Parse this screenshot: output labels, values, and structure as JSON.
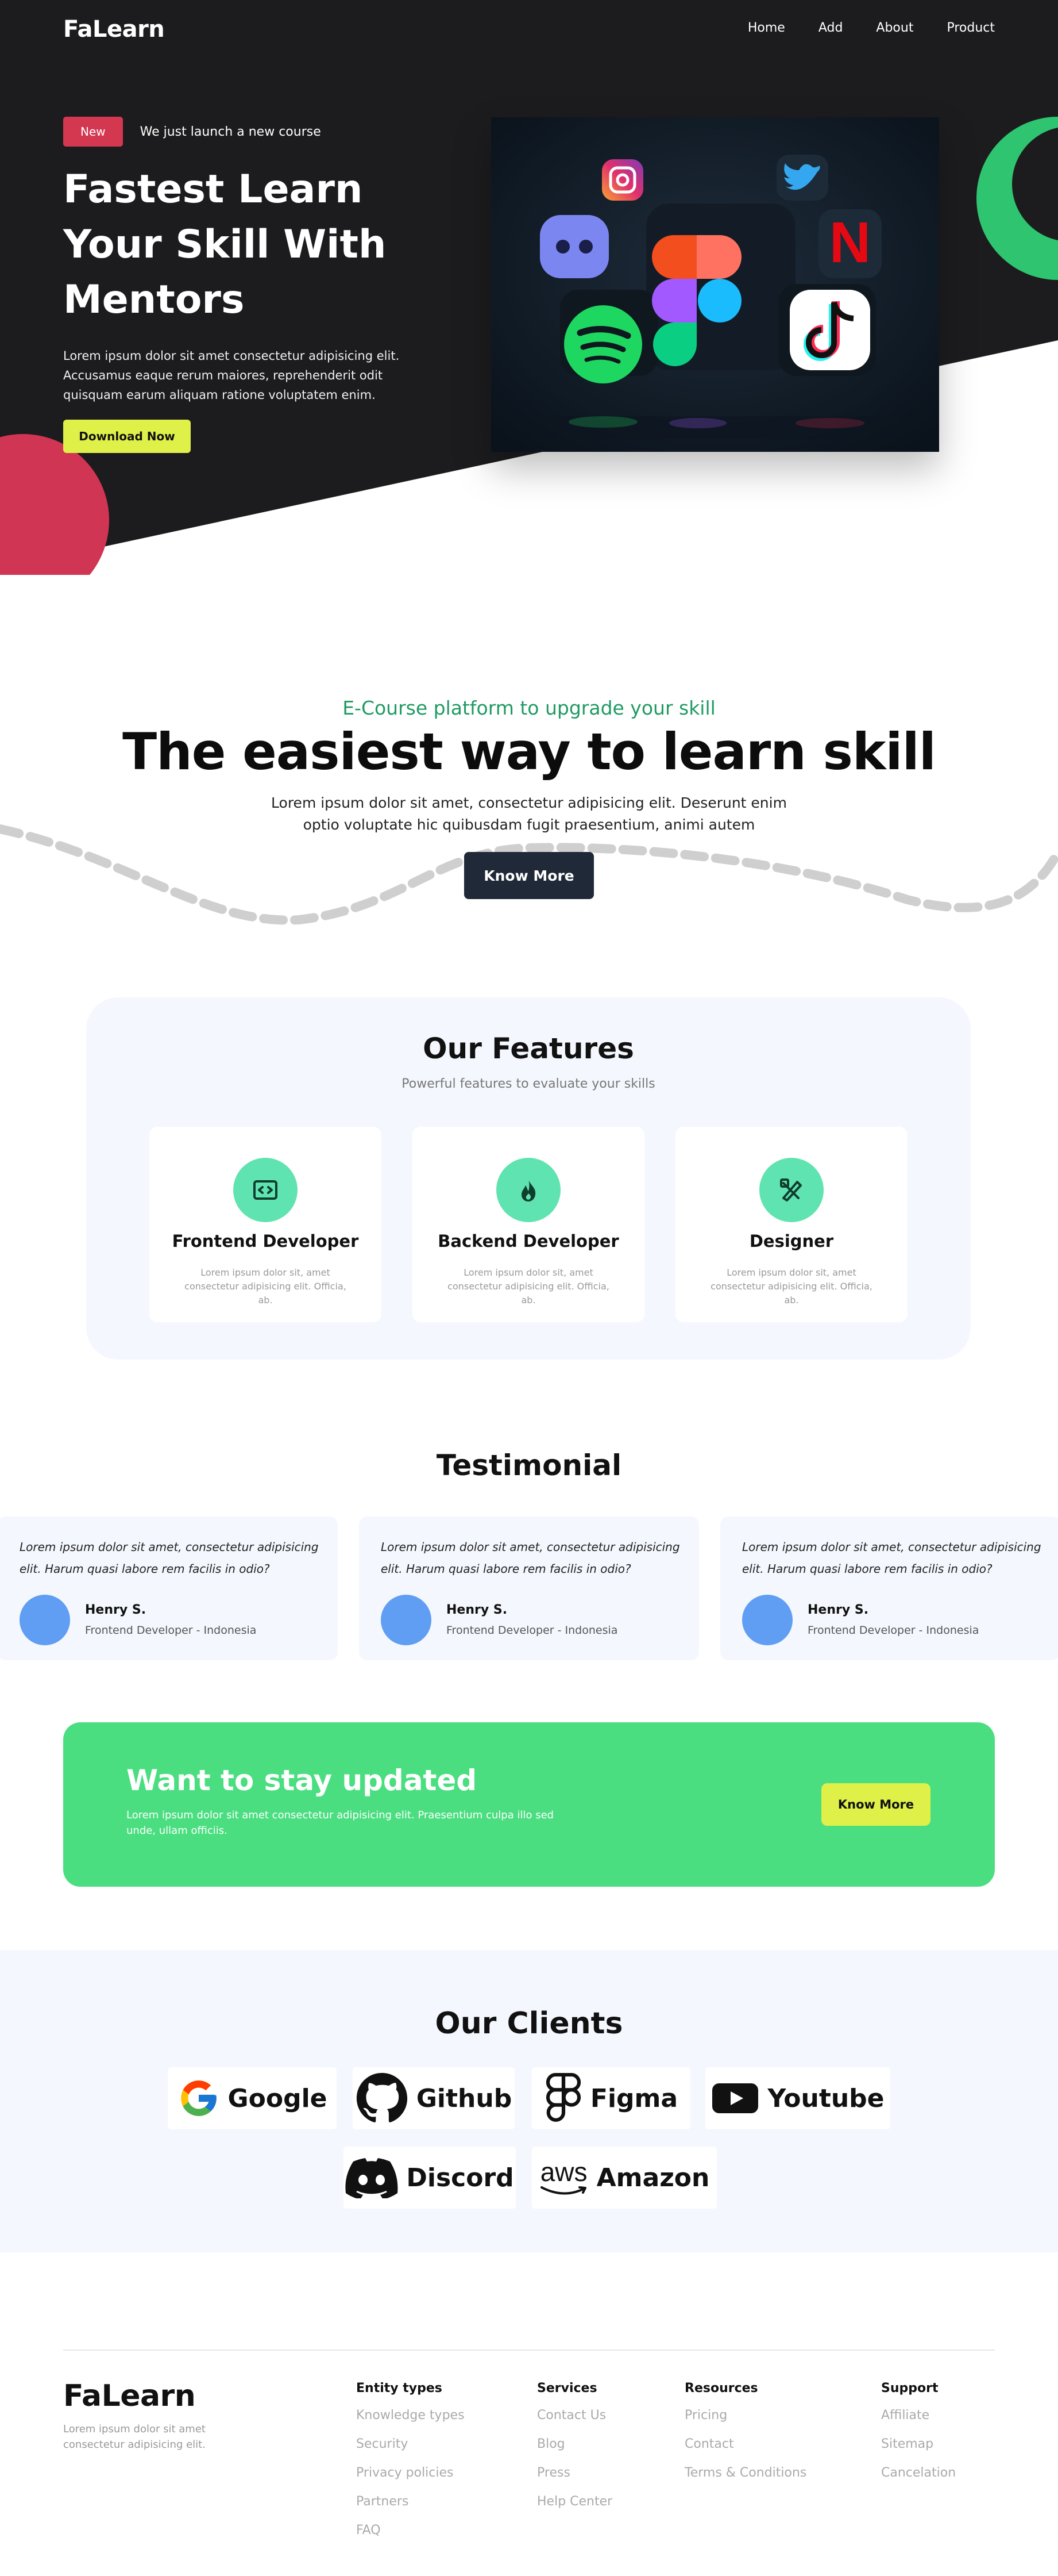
{
  "header": {
    "logo": "FaLearn",
    "nav": [
      "Home",
      "Add",
      "About",
      "Product"
    ]
  },
  "hero": {
    "badge": "New",
    "announcement": "We just launch a new course",
    "title": "Fastest Learn Your Skill With Mentors",
    "description": "Lorem ipsum dolor sit amet consectetur adipisicing elit. Accusamus eaque rerum maiores, reprehenderit odit quisquam earum aliquam ratione voluptatem enim.",
    "cta_label": "Download Now"
  },
  "intro": {
    "subtitle": "E-Course platform to upgrade your skill",
    "title": "The easiest way to learn skill",
    "description_line1": "Lorem ipsum dolor sit amet, consectetur adipisicing elit. Deserunt enim",
    "description_line2": "optio voluptate hic quibusdam fugit praesentium, animi autem",
    "button_label": "Know More"
  },
  "features": {
    "title": "Our Features",
    "subtitle": "Powerful features to evaluate your skills",
    "items": [
      {
        "name": "Frontend Developer",
        "description": "Lorem ipsum dolor sit, amet consectetur adipisicing elit. Officia, ab.",
        "icon": "code-icon"
      },
      {
        "name": "Backend Developer",
        "description": "Lorem ipsum dolor sit, amet consectetur adipisicing elit. Officia, ab.",
        "icon": "fire-icon"
      },
      {
        "name": "Designer",
        "description": "Lorem ipsum dolor sit, amet consectetur adipisicing elit. Officia, ab.",
        "icon": "design-tools-icon"
      }
    ]
  },
  "testimonial": {
    "title": "Testimonial",
    "items": [
      {
        "quote": "Lorem ipsum dolor sit amet, consectetur adipisicing elit. Harum quasi labore rem facilis in odio?",
        "name": "Henry S.",
        "role": "Frontend Developer - Indonesia"
      },
      {
        "quote": "Lorem ipsum dolor sit amet, consectetur adipisicing elit. Harum quasi labore rem facilis in odio?",
        "name": "Henry S.",
        "role": "Frontend Developer - Indonesia"
      },
      {
        "quote": "Lorem ipsum dolor sit amet, consectetur adipisicing elit. Harum quasi labore rem facilis in odio?",
        "name": "Henry S.",
        "role": "Frontend Developer - Indonesia"
      }
    ]
  },
  "cta": {
    "title": "Want to stay updated",
    "description": "Lorem ipsum dolor sit amet consectetur adipisicing elit. Praesentium culpa illo sed unde, ullam officiis.",
    "button_label": "Know More"
  },
  "clients": {
    "title": "Our Clients",
    "items": [
      {
        "name": "Google",
        "icon": "google-icon"
      },
      {
        "name": "Github",
        "icon": "github-icon"
      },
      {
        "name": "Figma",
        "icon": "figma-icon"
      },
      {
        "name": "Youtube",
        "icon": "youtube-icon"
      },
      {
        "name": "Discord",
        "icon": "discord-icon"
      },
      {
        "name": "Amazon",
        "icon": "aws-icon",
        "icon_text": "aws"
      }
    ]
  },
  "footer": {
    "logo": "FaLearn",
    "description": "Lorem ipsum dolor sit amet consectetur adipisicing elit.",
    "columns": [
      {
        "title": "Entity types",
        "links": [
          "Knowledge types",
          "Security",
          "Privacy policies",
          "Partners",
          "FAQ"
        ]
      },
      {
        "title": "Services",
        "links": [
          "Contact Us",
          "Blog",
          "Press",
          "Help Center"
        ]
      },
      {
        "title": "Resources",
        "links": [
          "Pricing",
          "Contact",
          "Terms & Conditions"
        ]
      },
      {
        "title": "Support",
        "links": [
          "Affiliate",
          "Sitemap",
          "Cancelation"
        ]
      }
    ]
  },
  "colors": {
    "hero_bg": "#1c1c1e",
    "accent_green": "#4ade80",
    "accent_yellow": "#dff048",
    "badge_red": "#d43851",
    "feature_icon_bg": "#5fe3b0",
    "dark_button": "#1f2937",
    "section_bg": "#f4f7fd",
    "avatar_blue": "#5f9ef3"
  }
}
